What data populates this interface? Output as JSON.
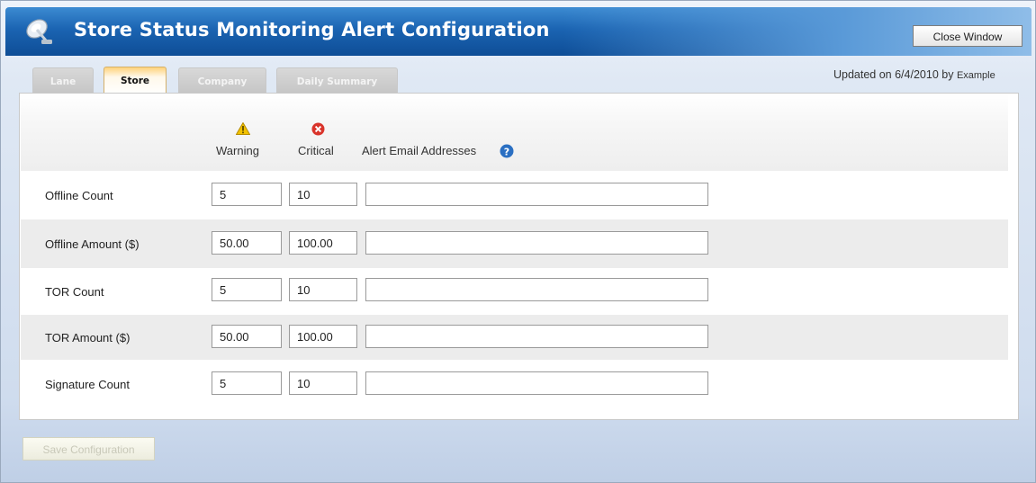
{
  "window": {
    "title": "Store Status Monitoring Alert Configuration",
    "close_label": "Close Window",
    "updated_text": "Updated on 6/4/2010 by",
    "updated_user": "Example"
  },
  "tabs": [
    {
      "label": "Lane",
      "active": false
    },
    {
      "label": "Store",
      "active": true
    },
    {
      "label": "Company",
      "active": false
    },
    {
      "label": "Daily Summary",
      "active": false
    }
  ],
  "columns": {
    "warning": "Warning",
    "critical": "Critical",
    "emails": "Alert Email Addresses"
  },
  "icons": {
    "warning": "warning-triangle-icon",
    "critical": "critical-x-icon",
    "help": "help-question-icon",
    "app": "satellite-dish-icon"
  },
  "rows": [
    {
      "label": "Offline Count",
      "warning": "5",
      "critical": "10",
      "emails": ""
    },
    {
      "label": "Offline Amount ($)",
      "warning": "50.00",
      "critical": "100.00",
      "emails": ""
    },
    {
      "label": "TOR Count",
      "warning": "5",
      "critical": "10",
      "emails": ""
    },
    {
      "label": "TOR Amount ($)",
      "warning": "50.00",
      "critical": "100.00",
      "emails": ""
    },
    {
      "label": "Signature Count",
      "warning": "5",
      "critical": "10",
      "emails": ""
    }
  ],
  "footer": {
    "save_label": "Save Configuration"
  },
  "colors": {
    "titlebar": "#1b64b2",
    "active_tab": "#ffd27a",
    "warning": "#f2c200",
    "critical": "#d9342b",
    "help": "#2a6fc2"
  }
}
